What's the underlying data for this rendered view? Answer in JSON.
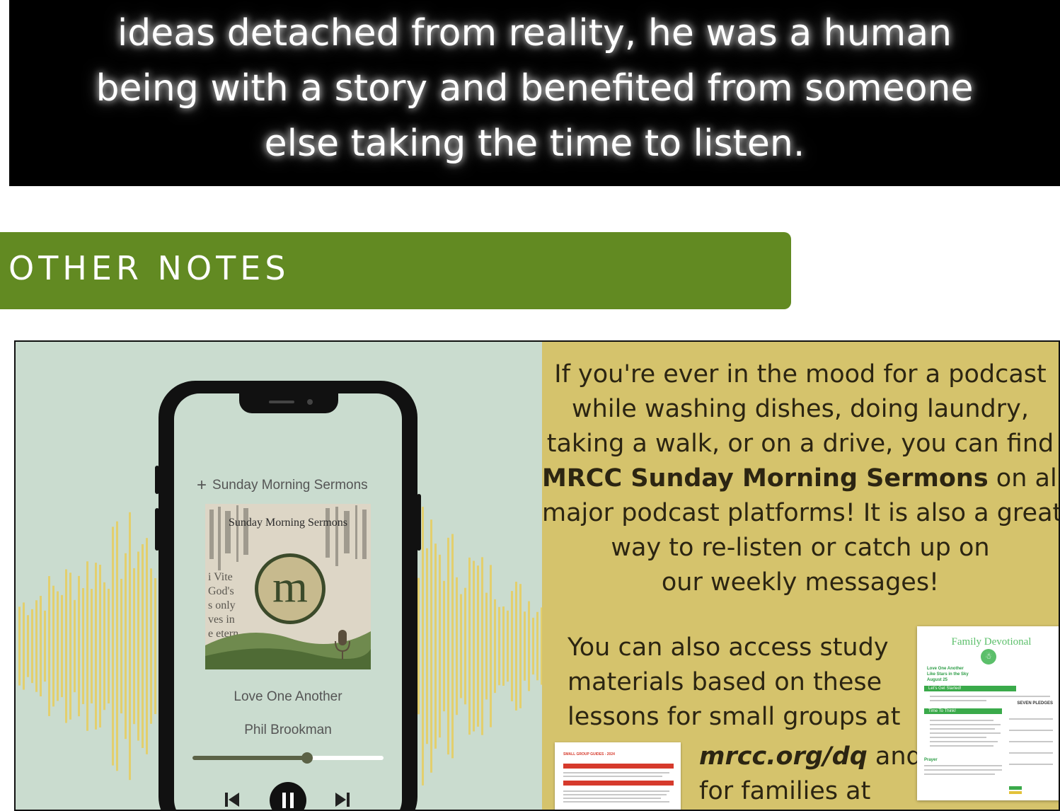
{
  "quote": {
    "lines": [
      "ideas detached from reality, he was a human",
      "being with a story and benefited from someone",
      "else taking the time to listen."
    ]
  },
  "section": {
    "title": "OTHER NOTES"
  },
  "podcast_player": {
    "add_label": "Sunday Morning Sermons",
    "cover_title": "Sunday Morning Sermons",
    "cover_logo_letter": "m",
    "track_title": "Love One Another",
    "track_artist": "Phil Brookman",
    "progress": 0.6
  },
  "promo": {
    "line1": "If you're ever in the mood for a podcast",
    "line2": "while washing dishes, doing laundry,",
    "line3": "taking a walk, or on a drive, you can find",
    "line4_bold": "MRCC Sunday Morning Sermons",
    "line4_rest": " on all",
    "line5": "major podcast platforms! It is also a great",
    "line6": "way to re-listen or catch up on",
    "line7": "our weekly messages!"
  },
  "study": {
    "line1": "You can also access study",
    "line2": "materials based on these",
    "line3": "lessons for small groups at",
    "link": "mrcc.org/dq",
    "link_rest": " and",
    "line5": "for families at"
  },
  "documents": {
    "small_group_title": "SMALL GROUP GUIDES - 2024",
    "family_title": "Family Devotional",
    "family_subtitle_1": "Love One Another",
    "family_subtitle_2": "Like Stars in the Sky",
    "family_subtitle_3": "August 25",
    "family_section_1": "Let's Get Started!",
    "family_section_2": "Time To Think!",
    "family_prayer": "Prayer",
    "family_badge": "SEVEN PLEDGES"
  },
  "colors": {
    "section_green": "#628a22",
    "left_panel_bg": "#cadccf",
    "right_panel_bg": "#d5c36c",
    "waveform": "#e3cf6d"
  }
}
